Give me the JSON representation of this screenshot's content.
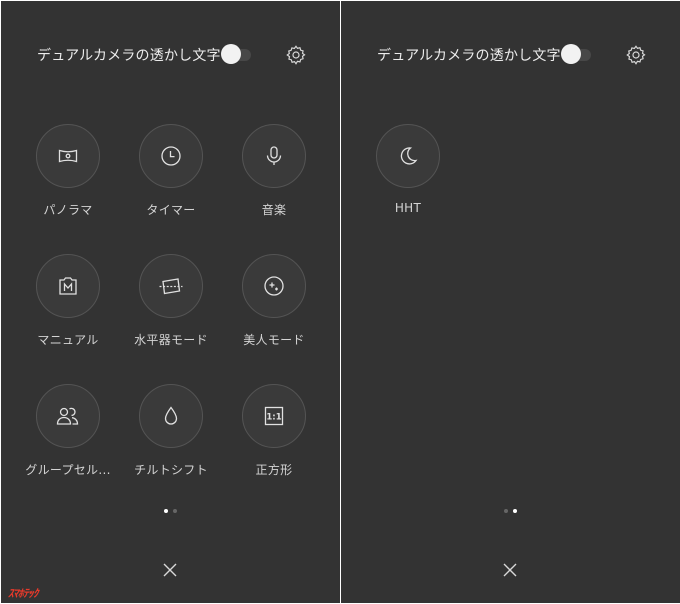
{
  "colors": {
    "background": "#333333",
    "text": "#e6e6e6",
    "circle_border": "#545454",
    "dot_active": "#ffffff",
    "dot_inactive": "#666666",
    "watermark": "#e83a2b"
  },
  "left_panel": {
    "header_title": "デュアルカメラの透かし文字",
    "toggle_state": "off",
    "tiles": [
      {
        "label": "パノラマ",
        "icon": "panorama-icon"
      },
      {
        "label": "タイマー",
        "icon": "timer-icon"
      },
      {
        "label": "音楽",
        "icon": "microphone-icon"
      },
      {
        "label": "マニュアル",
        "icon": "manual-icon"
      },
      {
        "label": "水平器モード",
        "icon": "level-icon"
      },
      {
        "label": "美人モード",
        "icon": "beauty-icon"
      },
      {
        "label": "グループセル...",
        "icon": "group-selfie-icon"
      },
      {
        "label": "チルトシフト",
        "icon": "tilt-shift-icon"
      },
      {
        "label": "正方形",
        "icon": "square-icon",
        "glyph": "1:1"
      }
    ],
    "page_indicator": {
      "current": 1,
      "total": 2
    }
  },
  "right_panel": {
    "header_title": "デュアルカメラの透かし文字",
    "toggle_state": "off",
    "tiles": [
      {
        "label": "HHT",
        "icon": "moon-icon"
      }
    ],
    "page_indicator": {
      "current": 2,
      "total": 2
    }
  },
  "watermark_text": "ｽﾏﾎﾃｯｸ"
}
